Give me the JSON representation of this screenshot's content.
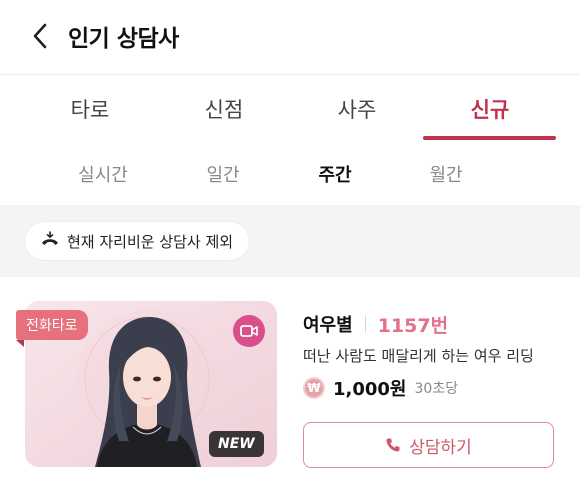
{
  "header": {
    "title": "인기 상담사",
    "back_icon": "chevron-left-icon"
  },
  "main_tabs": [
    {
      "label": "타로",
      "active": false
    },
    {
      "label": "신점",
      "active": false
    },
    {
      "label": "사주",
      "active": false
    },
    {
      "label": "신규",
      "active": true
    }
  ],
  "sub_tabs": [
    {
      "label": "실시간",
      "active": false
    },
    {
      "label": "일간",
      "active": false
    },
    {
      "label": "주간",
      "active": true
    },
    {
      "label": "월간",
      "active": false
    }
  ],
  "filter": {
    "label": "현재 자리비운 상담사 제외",
    "icon": "phone-hangup-icon"
  },
  "counselor": {
    "badge": "전화타로",
    "new_badge": "NEW",
    "video_icon": "video-camera-icon",
    "name": "여우별",
    "number": "1157번",
    "description": "떠난 사람도 매달리게 하는 여우 리딩",
    "currency_symbol": "₩",
    "price": "1,000원",
    "price_unit": "30초당",
    "consult_label": "상담하기",
    "consult_icon": "phone-icon"
  },
  "colors": {
    "accent": "#c0334d",
    "badge": "#e7707d",
    "number": "#e0728a",
    "video": "#d84f8c"
  }
}
